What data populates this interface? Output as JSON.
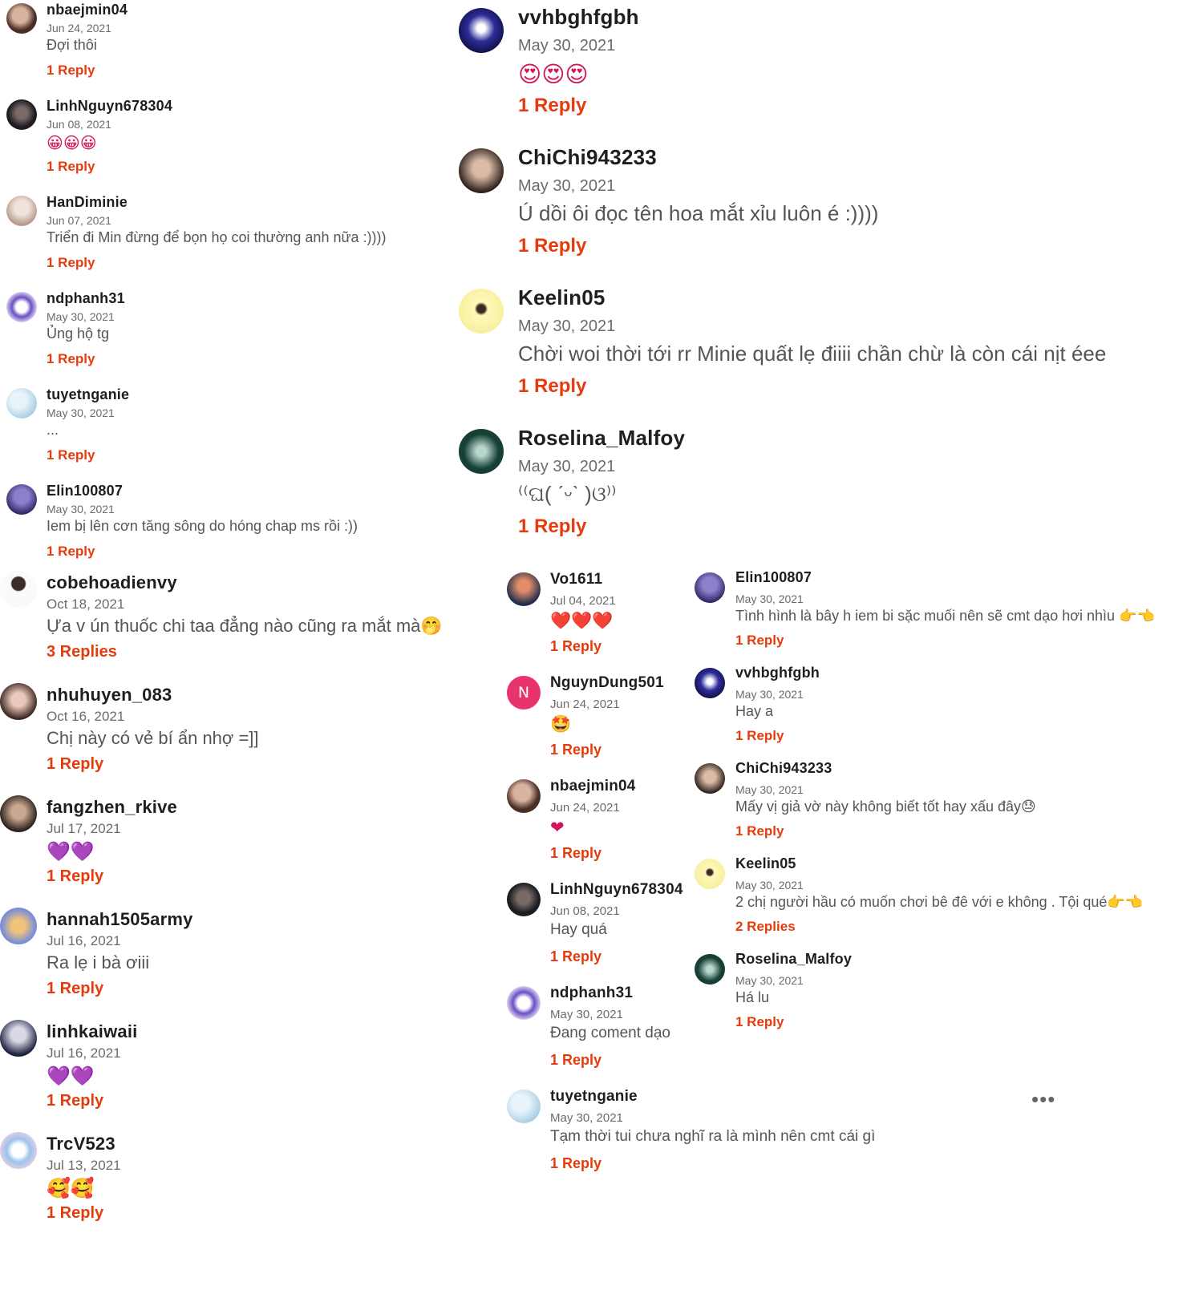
{
  "colors": {
    "reply": "#e63b0d",
    "name": "#1e1e1e",
    "date": "#6b6b6b",
    "text": "#555555"
  },
  "left_comments": [
    {
      "name": "nbaejmin04",
      "date": "Jun 24, 2021",
      "text": "Đợi thôi",
      "reply": "1 Reply"
    },
    {
      "name": "LinhNguyn678304",
      "date": "Jun 08, 2021",
      "text": "😀😀😀",
      "reply": "1 Reply"
    },
    {
      "name": "HanDiminie",
      "date": "Jun 07, 2021",
      "text": "Triển đi Min đừng để bọn họ coi thường anh nữa :))))",
      "reply": "1 Reply"
    },
    {
      "name": "ndphanh31",
      "date": "May 30, 2021",
      "text": "Ủng hộ tg",
      "reply": "1 Reply"
    },
    {
      "name": "tuyetnganie",
      "date": "May 30, 2021",
      "text": "...",
      "reply": "1 Reply"
    },
    {
      "name": "Elin100807",
      "date": "May 30, 2021",
      "text": "Iem bị lên cơn tăng sông do hóng chap ms rồi :))",
      "reply": "1 Reply"
    },
    {
      "name": "cobehoadienvy",
      "date": "Oct 18, 2021",
      "text": "Ựa v ún thuốc chi taa đẳng nào cũng ra mắt mà🤭",
      "reply": "3 Replies"
    },
    {
      "name": "nhuhuyen_083",
      "date": "Oct 16, 2021",
      "text": "Chị này có vẻ bí ẩn nhợ =]]",
      "reply": "1 Reply"
    },
    {
      "name": "fangzhen_rkive",
      "date": "Jul 17, 2021",
      "text": "💜💜",
      "reply": "1 Reply"
    },
    {
      "name": "hannah1505army",
      "date": "Jul 16, 2021",
      "text": "Ra lẹ i bà ơiii",
      "reply": "1 Reply"
    },
    {
      "name": "linhkaiwaii",
      "date": "Jul 16, 2021",
      "text": "💜💜",
      "reply": "1 Reply"
    },
    {
      "name": "TrcV523",
      "date": "Jul 13, 2021",
      "text": "🥰🥰",
      "reply": "1 Reply"
    }
  ],
  "top_right_comments": [
    {
      "name": "vvhbghfgbh",
      "date": "May 30, 2021",
      "text": "😍😍😍",
      "reply": "1 Reply"
    },
    {
      "name": "ChiChi943233",
      "date": "May 30, 2021",
      "text": "Ú dồi ôi đọc tên hoa mắt xỉu luôn é :))))",
      "reply": "1 Reply"
    },
    {
      "name": "Keelin05",
      "date": "May 30, 2021",
      "text": "Chời woi thời tới rr Minie quất lẹ điiii chần chừ là còn cái nịt éee",
      "reply": "1 Reply"
    },
    {
      "name": "Roselina_Malfoy",
      "date": "May 30, 2021",
      "text": "⁽⁽ଘ( ˊᵕˋ )ଓ⁾⁾",
      "reply": "1 Reply"
    }
  ],
  "mid_comments": [
    {
      "name": "Vo1611",
      "date": "Jul 04, 2021",
      "text": "❤️❤️❤️",
      "reply": "1 Reply"
    },
    {
      "name": "NguynDung501",
      "date": "Jun 24, 2021",
      "text": "🤩",
      "reply": "1 Reply",
      "initial": "N"
    },
    {
      "name": "nbaejmin04",
      "date": "Jun 24, 2021",
      "text": "❤",
      "reply": "1 Reply"
    },
    {
      "name": "LinhNguyn678304",
      "date": "Jun 08, 2021",
      "text": "Hay quá",
      "reply": "1 Reply"
    },
    {
      "name": "ndphanh31",
      "date": "May 30, 2021",
      "text": "Đang coment dạo",
      "reply": "1 Reply"
    },
    {
      "name": "tuyetnganie",
      "date": "May 30, 2021",
      "text": "Tạm thời tui chưa nghĩ ra là mình nên cmt cái gì",
      "reply": "1 Reply"
    }
  ],
  "far_right_comments": [
    {
      "name": "Elin100807",
      "date": "May 30, 2021",
      "text": "Tình hình là bây h iem bi sặc muối nên sẽ cmt dạo hơi nhìu 👉👈",
      "reply": "1 Reply"
    },
    {
      "name": "vvhbghfgbh",
      "date": "May 30, 2021",
      "text": "Hay a",
      "reply": "1 Reply"
    },
    {
      "name": "ChiChi943233",
      "date": "May 30, 2021",
      "text": "Mấy vị giả vờ này không biết tốt hay xấu đây😓",
      "reply": "1 Reply"
    },
    {
      "name": "Keelin05",
      "date": "May 30, 2021",
      "text": "2 chị người hầu có muốn chơi bê đê với e không . Tội qué👉👈",
      "reply": "2 Replies"
    },
    {
      "name": "Roselina_Malfoy",
      "date": "May 30, 2021",
      "text": "Há lu",
      "reply": "1 Reply"
    }
  ],
  "more_menu": "•••"
}
